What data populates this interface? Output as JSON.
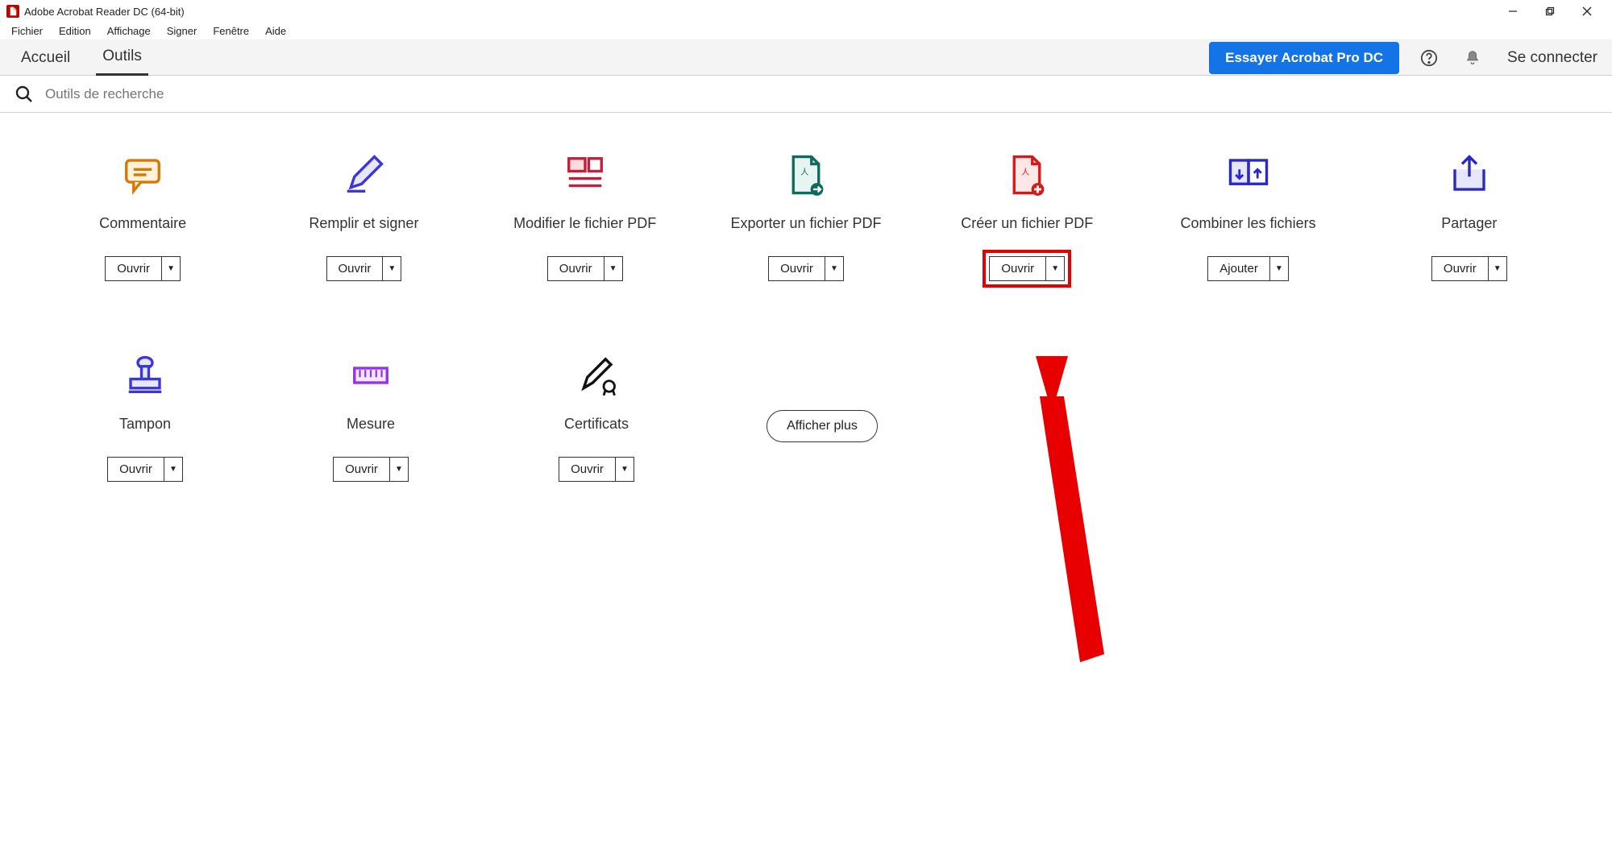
{
  "window": {
    "title": "Adobe Acrobat Reader DC (64-bit)"
  },
  "menu": {
    "items": [
      "Fichier",
      "Edition",
      "Affichage",
      "Signer",
      "Fenêtre",
      "Aide"
    ]
  },
  "tabbar": {
    "tab_home": "Accueil",
    "tab_tools": "Outils",
    "cta": "Essayer Acrobat Pro DC",
    "signin": "Se connecter"
  },
  "search": {
    "placeholder": "Outils de recherche"
  },
  "row1": [
    {
      "name": "commentaire",
      "label": "Commentaire",
      "action": "Ouvrir",
      "icon": "comment",
      "highlight": false
    },
    {
      "name": "remplir-signer",
      "label": "Remplir et signer",
      "action": "Ouvrir",
      "icon": "pen",
      "highlight": false
    },
    {
      "name": "modifier-pdf",
      "label": "Modifier le fichier PDF",
      "action": "Ouvrir",
      "icon": "edit-doc",
      "highlight": false
    },
    {
      "name": "exporter-pdf",
      "label": "Exporter un fichier PDF",
      "action": "Ouvrir",
      "icon": "export",
      "highlight": false
    },
    {
      "name": "creer-pdf",
      "label": "Créer un fichier PDF",
      "action": "Ouvrir",
      "icon": "create",
      "highlight": true
    },
    {
      "name": "combiner",
      "label": "Combiner les fichiers",
      "action": "Ajouter",
      "icon": "combine",
      "highlight": false
    },
    {
      "name": "partager",
      "label": "Partager",
      "action": "Ouvrir",
      "icon": "share",
      "highlight": false
    }
  ],
  "row2": [
    {
      "name": "tampon",
      "label": "Tampon",
      "action": "Ouvrir",
      "icon": "stamp",
      "highlight": false
    },
    {
      "name": "mesure",
      "label": "Mesure",
      "action": "Ouvrir",
      "icon": "ruler",
      "highlight": false
    },
    {
      "name": "certificats",
      "label": "Certificats",
      "action": "Ouvrir",
      "icon": "cert",
      "highlight": false
    }
  ],
  "show_more": "Afficher plus"
}
